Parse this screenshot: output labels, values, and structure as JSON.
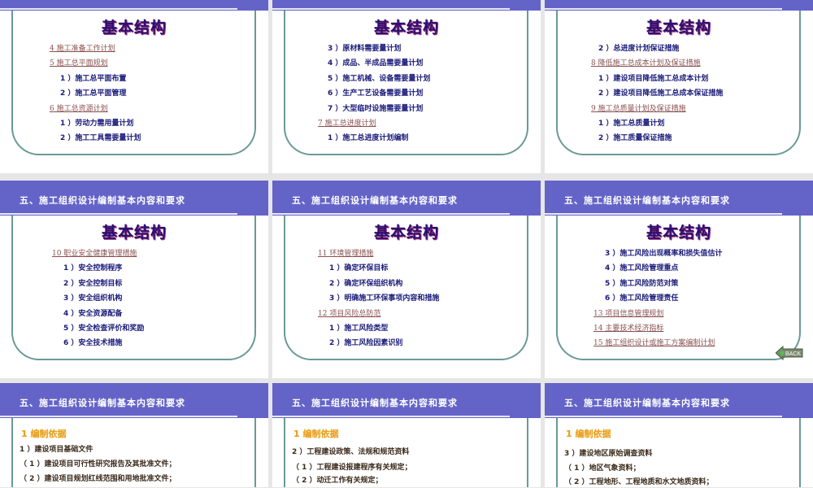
{
  "header_title": "五、施工组织设计编制基本内容和要求",
  "big_title": "基本结构",
  "slides": [
    {
      "items": [
        {
          "t": "link",
          "text": "4   施工准备工作计划"
        },
        {
          "t": "link",
          "text": "5   施工总平面规划"
        },
        {
          "t": "sub",
          "text": "1 ）施工总平面布置"
        },
        {
          "t": "sub",
          "text": "2 ）施工总平面管理"
        },
        {
          "t": "link",
          "text": "6   施工总资源计划"
        },
        {
          "t": "sub",
          "text": "1 ）劳动力需用量计划"
        },
        {
          "t": "sub",
          "text": "2 ）施工工具需要量计划"
        }
      ]
    },
    {
      "items": [
        {
          "t": "sub",
          "text": "3 ）原材料需要量计划"
        },
        {
          "t": "sub",
          "text": "4 ）成品、半成品需要量计划"
        },
        {
          "t": "sub",
          "text": "5 ）施工机械、设备需要量计划"
        },
        {
          "t": "sub",
          "text": "6 ）生产工艺设备需要量计划"
        },
        {
          "t": "sub",
          "text": "7 ）大型临时设施需要量计划"
        },
        {
          "t": "link",
          "text": "7   施工总进度计划"
        },
        {
          "t": "sub",
          "text": "1 ）施工总进度计划编制"
        }
      ]
    },
    {
      "items": [
        {
          "t": "sub",
          "text": "2 ）总进度计划保证措施"
        },
        {
          "t": "link",
          "text": "8   降低施工总成本计划及保证措施"
        },
        {
          "t": "sub",
          "text": "1 ）建设项目降低施工总成本计划"
        },
        {
          "t": "sub",
          "text": "2 ）建设项目降低施工总成本保证措施"
        },
        {
          "t": "link",
          "text": "9   施工总质量计划及保证措施"
        },
        {
          "t": "sub",
          "text": "1 ）施工总质量计划"
        },
        {
          "t": "sub",
          "text": "2 ）施工质量保证措施"
        }
      ]
    },
    {
      "items": [
        {
          "t": "link",
          "text": "10   职业安全健康管理措施"
        },
        {
          "t": "sub",
          "text": "1 ）安全控制程序"
        },
        {
          "t": "sub",
          "text": "2 ）安全控制目标"
        },
        {
          "t": "sub",
          "text": "3 ）安全组织机构"
        },
        {
          "t": "sub",
          "text": "4 ）安全资源配备"
        },
        {
          "t": "sub",
          "text": "5 ）安全检查评价和奖励"
        },
        {
          "t": "sub",
          "text": "6 ）安全技术措施"
        }
      ]
    },
    {
      "items": [
        {
          "t": "link",
          "text": "11   环境管理措施"
        },
        {
          "t": "sub",
          "text": "1 ）确定环保目标"
        },
        {
          "t": "sub",
          "text": "2 ）确定环保组织机构"
        },
        {
          "t": "sub",
          "text": "3 ）明确施工环保事项内容和措施"
        },
        {
          "t": "link",
          "text": "12   项目风险总防范"
        },
        {
          "t": "sub",
          "text": "1 ）施工风险类型"
        },
        {
          "t": "sub",
          "text": "2 ）施工风险因素识别"
        }
      ]
    },
    {
      "items": [
        {
          "t": "sub",
          "text": "3 ）施工风险出现概率和损失值估计"
        },
        {
          "t": "sub",
          "text": "4 ）施工风险管理重点"
        },
        {
          "t": "sub",
          "text": "5 ）施工风险防范对策"
        },
        {
          "t": "sub",
          "text": "6 ）施工风险管理责任"
        },
        {
          "t": "link",
          "text": "13   项目信息管理规划"
        },
        {
          "t": "link",
          "text": "14   主要技术经济指标"
        },
        {
          "t": "link",
          "text": "15   施工组织设计或施工方案编制计划"
        }
      ],
      "back_label": "BACK"
    },
    {
      "section": "1  编制依据",
      "paras": [
        "1 ）建设项目基础文件",
        "（ 1 ）建设项目可行性研究报告及其批准文件；",
        "（ 2 ）建设项目规划红线范围和用地批准文件；"
      ]
    },
    {
      "section": "1  编制依据",
      "paras": [
        "2 ）工程建设政策、法规和规范资料",
        "（ 1 ）工程建设报建程序有关规定；",
        "（ 2 ）动迁工作有关规定；"
      ]
    },
    {
      "section": "1  编制依据",
      "paras": [
        "3 ）建设地区原始调查资料",
        "（ 1 ）地区气象资料；",
        "（ 2 ）工程地形、工程地质和水文地质资料；"
      ]
    }
  ]
}
